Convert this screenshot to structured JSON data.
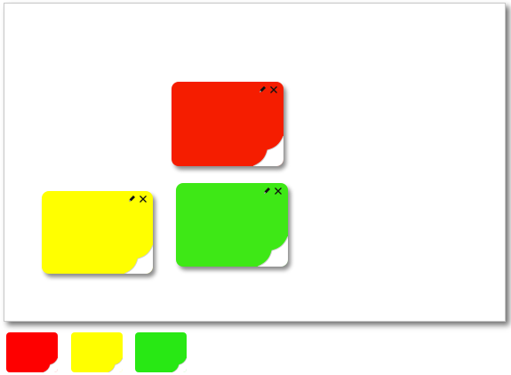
{
  "board": {
    "notes": [
      {
        "id": "red",
        "color": "#f51d00",
        "edit_icon": "pencil-icon",
        "close_icon": "close-icon"
      },
      {
        "id": "green",
        "color": "#3ee816",
        "edit_icon": "pencil-icon",
        "close_icon": "close-icon"
      },
      {
        "id": "yellow",
        "color": "#ffff00",
        "edit_icon": "pencil-icon",
        "close_icon": "close-icon"
      }
    ]
  },
  "palette": {
    "swatches": [
      {
        "color": "#fe0000"
      },
      {
        "color": "#ffff00"
      },
      {
        "color": "#28e814"
      }
    ]
  }
}
